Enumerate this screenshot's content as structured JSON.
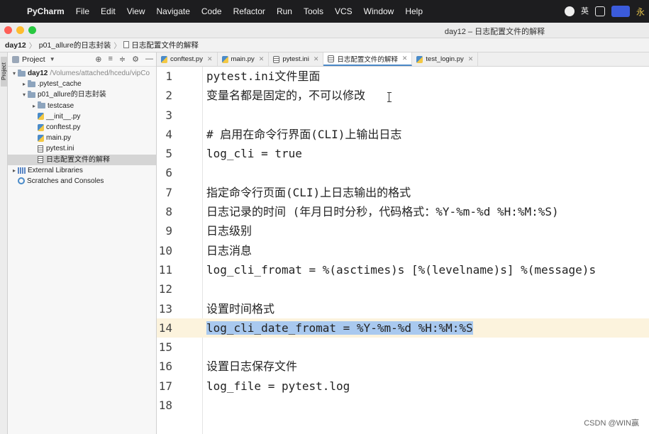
{
  "menubar": {
    "app": "PyCharm",
    "items": [
      "File",
      "Edit",
      "View",
      "Navigate",
      "Code",
      "Refactor",
      "Run",
      "Tools",
      "VCS",
      "Window",
      "Help"
    ],
    "input_method": "英",
    "user_fragment": "永"
  },
  "window": {
    "title": "day12 – 日志配置文件的解释"
  },
  "breadcrumb": {
    "project": "day12",
    "folder": "p01_allure的日志封装",
    "file": "日志配置文件的解释"
  },
  "toolstrip": {
    "project_label": "Project"
  },
  "project_panel": {
    "header": "Project",
    "tree": [
      {
        "label": "day12",
        "path": "/Volumes/attached/hcedu/vipCo",
        "kind": "folder",
        "depth": 0,
        "arrow": "▾",
        "bold": true
      },
      {
        "label": ".pytest_cache",
        "kind": "folder",
        "depth": 1,
        "arrow": "▸"
      },
      {
        "label": "p01_allure的日志封装",
        "kind": "folder",
        "depth": 1,
        "arrow": "▾"
      },
      {
        "label": "testcase",
        "kind": "folder",
        "depth": 2,
        "arrow": "▸"
      },
      {
        "label": "__init__.py",
        "kind": "py",
        "depth": 2
      },
      {
        "label": "conftest.py",
        "kind": "py",
        "depth": 2
      },
      {
        "label": "main.py",
        "kind": "py",
        "depth": 2
      },
      {
        "label": "pytest.ini",
        "kind": "ini",
        "depth": 2
      },
      {
        "label": "日志配置文件的解释",
        "kind": "ini",
        "depth": 2,
        "selected": true
      },
      {
        "label": "External Libraries",
        "kind": "lib",
        "depth": 0,
        "arrow": "▸"
      },
      {
        "label": "Scratches and Consoles",
        "kind": "scratch",
        "depth": 0
      }
    ]
  },
  "tabs": [
    {
      "label": "conftest.py",
      "kind": "py"
    },
    {
      "label": "main.py",
      "kind": "py"
    },
    {
      "label": "pytest.ini",
      "kind": "ini"
    },
    {
      "label": "日志配置文件的解释",
      "kind": "ini",
      "active": true
    },
    {
      "label": "test_login.py",
      "kind": "py"
    }
  ],
  "editor": {
    "current_line": 14,
    "lines": [
      "pytest.ini文件里面",
      "变量名都是固定的，不可以修改",
      "",
      "# 启用在命令行界面(CLI)上输出日志",
      "log_cli = true",
      "",
      "指定命令行页面(CLI)上日志输出的格式",
      "日志记录的时间 (年月日时分秒，代码格式：%Y-%m-%d %H:%M:%S)",
      "日志级别",
      "日志消息",
      "log_cli_fromat = %(asctimes)s [%(levelname)s] %(message)s",
      "",
      "设置时间格式",
      "log_cli_date_fromat = %Y-%m-%d %H:%M:%S",
      "",
      "设置日志保存文件",
      "log_file = pytest.log",
      ""
    ]
  },
  "watermark": "CSDN @WIN赢"
}
